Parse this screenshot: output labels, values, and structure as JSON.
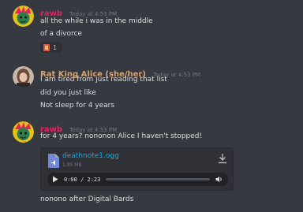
{
  "colors": {
    "background": "#36393f",
    "rawb_name": "#e91e63",
    "alice_name": "#d4a373",
    "link": "#00b0f4"
  },
  "messages": [
    {
      "username": "rawb",
      "timestamp": "Today at 4:53 PM",
      "lines": [
        "all the while i was in the middle",
        "of a divorce"
      ],
      "reaction": {
        "icon": "custom-emoji",
        "count": "1"
      }
    },
    {
      "username": "Rat King Alice (she/her)",
      "timestamp": "Today at 4:53 PM",
      "lines": [
        "I am tired from just reading that list",
        "did you just like",
        "Not sleep for 4 years"
      ]
    },
    {
      "username": "rawb",
      "timestamp": "Today at 4:53 PM",
      "lines": [
        "for 4 years? nononon Alice I haven't stopped!",
        "nonono after Digital Bards"
      ],
      "attachment": {
        "file_name": "deathnote1.ogg",
        "file_size": "1.95 MB",
        "player_time": "0:00 / 2:23",
        "progress": 0,
        "icons": {
          "file": "audio-file-icon",
          "download": "download-icon",
          "play": "play-icon",
          "volume": "volume-icon"
        }
      }
    }
  ]
}
